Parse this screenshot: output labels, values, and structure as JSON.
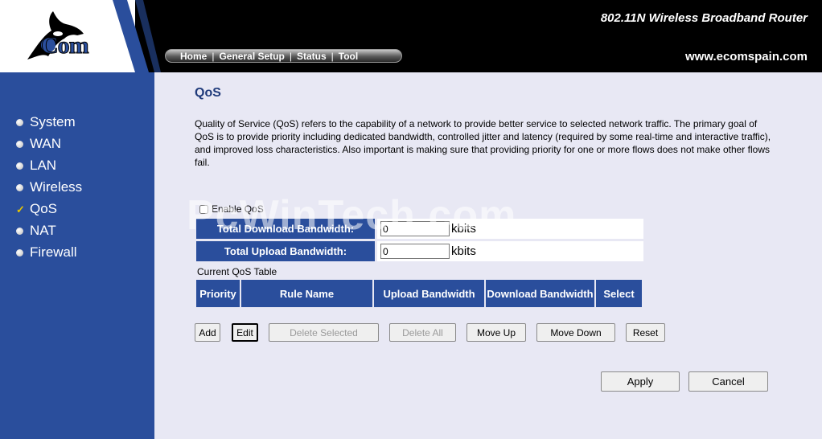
{
  "header": {
    "product_name": "802.11N Wireless Broadband Router",
    "website": "www.ecomspain.com",
    "logo_text": "Com",
    "nav": [
      {
        "label": "Home"
      },
      {
        "label": "General Setup"
      },
      {
        "label": "Status"
      },
      {
        "label": "Tool"
      }
    ]
  },
  "sidebar": {
    "items": [
      {
        "label": "System",
        "icon": "bullet-icon",
        "selected": false
      },
      {
        "label": "WAN",
        "icon": "bullet-icon",
        "selected": false
      },
      {
        "label": "LAN",
        "icon": "bullet-icon",
        "selected": false
      },
      {
        "label": "Wireless",
        "icon": "bullet-icon",
        "selected": false
      },
      {
        "label": "QoS",
        "icon": "checkmark-icon",
        "selected": true
      },
      {
        "label": "NAT",
        "icon": "bullet-icon",
        "selected": false
      },
      {
        "label": "Firewall",
        "icon": "bullet-icon",
        "selected": false
      }
    ]
  },
  "main": {
    "title": "QoS",
    "description": "Quality of Service (QoS) refers to the capability of a network to provide better service to selected network traffic. The primary goal of QoS is to provide priority including dedicated bandwidth, controlled jitter and latency (required by some real-time and interactive traffic), and improved loss characteristics. Also important is making sure that providing priority for one or more flows does not make other flows fail.",
    "watermark": "PcWinTech.com",
    "enable_qos": {
      "label": "Enable QoS",
      "checked": false
    },
    "download": {
      "label": "Total Download Bandwidth:",
      "value": "0",
      "unit": "kbits"
    },
    "upload": {
      "label": "Total Upload Bandwidth:",
      "value": "0",
      "unit": "kbits"
    },
    "table": {
      "caption": "Current QoS Table",
      "columns": [
        "Priority",
        "Rule Name",
        "Upload Bandwidth",
        "Download Bandwidth",
        "Select"
      ]
    },
    "buttons": {
      "add": "Add",
      "edit": "Edit",
      "delete_selected": "Delete Selected",
      "delete_all": "Delete All",
      "move_up": "Move Up",
      "move_down": "Move Down",
      "reset": "Reset",
      "apply": "Apply",
      "cancel": "Cancel"
    }
  },
  "colors": {
    "sidebar_blue": "#2a4e9c",
    "header_black": "#000000",
    "page_bg": "#e8e8f4",
    "selected_check": "#e6c500"
  }
}
